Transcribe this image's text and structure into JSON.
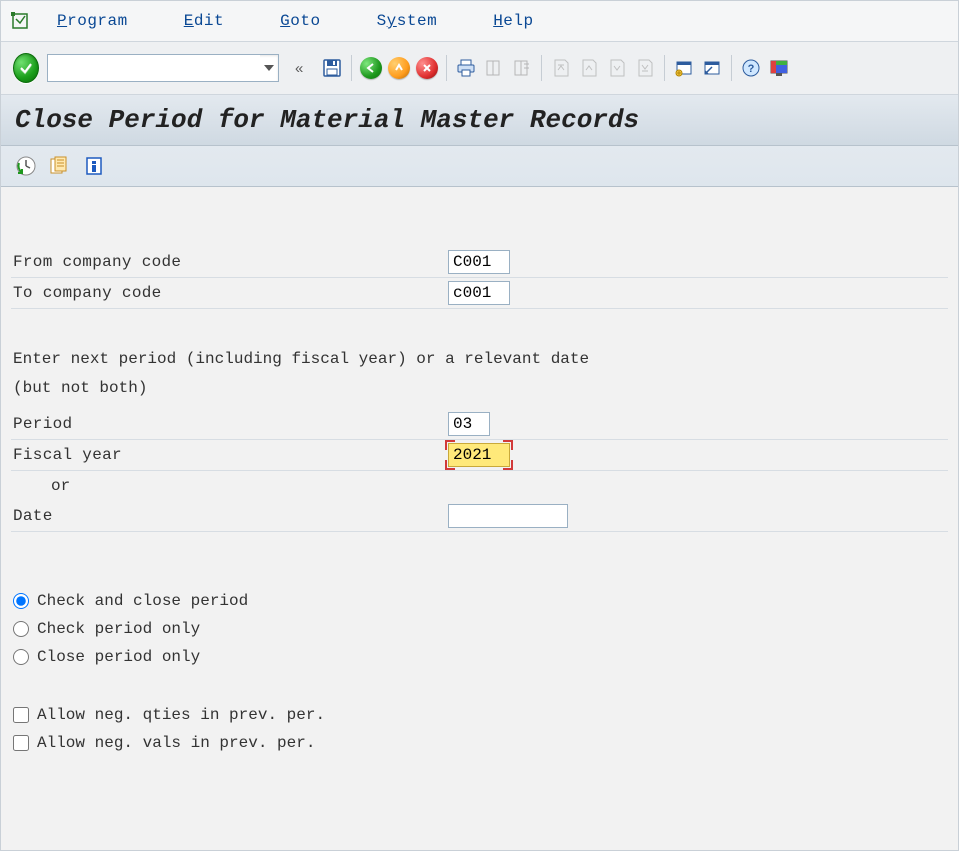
{
  "menu": {
    "program": "Program",
    "edit": "Edit",
    "goto": "Goto",
    "system": "System",
    "help": "Help"
  },
  "toolbar": {
    "tcode": "",
    "chevrons": "«"
  },
  "page_title": "Close Period for Material Master Records",
  "fields": {
    "from_cc_label": "From company code",
    "from_cc_value": "C001",
    "to_cc_label": "To company code",
    "to_cc_value": "c001",
    "instruction_line1": "Enter next period (including fiscal year) or a relevant date",
    "instruction_line2": "(but not both)",
    "period_label": "Period",
    "period_value": "03",
    "fiscal_label": "Fiscal year",
    "fiscal_value": "2021",
    "or_label": "or",
    "date_label": "Date",
    "date_value": ""
  },
  "radios": {
    "check_close": "Check and close period",
    "check_only": "Check period only",
    "close_only": "Close period only"
  },
  "checks": {
    "neg_qty": "Allow neg. qties in prev. per.",
    "neg_val": "Allow neg. vals in prev. per."
  }
}
